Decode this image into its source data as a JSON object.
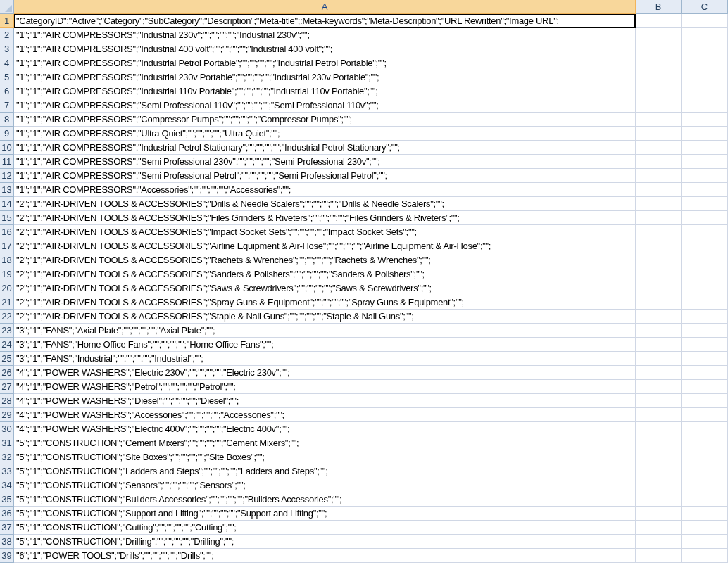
{
  "sheet": {
    "columns": [
      {
        "label": "A",
        "selected": true
      },
      {
        "label": "B",
        "selected": false
      },
      {
        "label": "C",
        "selected": false
      }
    ],
    "rows": [
      {
        "number": "1",
        "selected": true,
        "cell_a": "\"CategoryID\";\"Active\";\"Category\";\"SubCategory\";\"Description\";\"Meta-title\";:Meta-keywords\";\"Meta-Description\";\"URL Rewritten\";\"Image URL\";"
      },
      {
        "number": "2",
        "selected": false,
        "cell_a": "\"1\";\"1\";\"AIR COMPRESSORS\";\"Industrial 230v\";\"\";\"\";\"\";\"\";\"Industrial 230v\";\"\";"
      },
      {
        "number": "3",
        "selected": false,
        "cell_a": "\"1\";\"1\";\"AIR COMPRESSORS\";\"Industrial 400 volt\";\"\";\"\";\"\";\"\";\"Industrial 400 volt\";\"\";"
      },
      {
        "number": "4",
        "selected": false,
        "cell_a": "\"1\";\"1\";\"AIR COMPRESSORS\";\"Industrial Petrol Portable\";\"\";\"\";\"\";\"\";\"Industrial Petrol Portable\";\"\";"
      },
      {
        "number": "5",
        "selected": false,
        "cell_a": "\"1\";\"1\";\"AIR COMPRESSORS\";\"Industrial 230v Portable\";\"\";\"\";\"\";\"\";\"Industrial 230v Portable\";\"\";"
      },
      {
        "number": "6",
        "selected": false,
        "cell_a": "\"1\";\"1\";\"AIR COMPRESSORS\";\"Industrial 110v Portable\";\"\";\"\";\"\";\"\";\"Industrial 110v Portable\";\"\";"
      },
      {
        "number": "7",
        "selected": false,
        "cell_a": "\"1\";\"1\";\"AIR COMPRESSORS\";\"Semi Professional 110v\";\"\";\"\";\"\";\"\";\"Semi Professional 110v\";\"\";"
      },
      {
        "number": "8",
        "selected": false,
        "cell_a": "\"1\";\"1\";\"AIR COMPRESSORS\";\"Compressor Pumps\";\"\";\"\";\"\";\"\";\"Compressor Pumps\";\"\";"
      },
      {
        "number": "9",
        "selected": false,
        "cell_a": "\"1\";\"1\";\"AIR COMPRESSORS\";\"Ultra Quiet\";\"\";\"\";\"\";\"\";\"Ultra Quiet\";\"\";"
      },
      {
        "number": "10",
        "selected": false,
        "cell_a": "\"1\";\"1\";\"AIR COMPRESSORS\";\"Industrial Petrol Stationary\";\"\";\"\";\"\";\"\";\"Industrial Petrol Stationary\";\"\";"
      },
      {
        "number": "11",
        "selected": false,
        "cell_a": "\"1\";\"1\";\"AIR COMPRESSORS\";\"Semi Professional 230v\";\"\";\"\";\"\";\"\";\"Semi Professional 230v\";\"\";"
      },
      {
        "number": "12",
        "selected": false,
        "cell_a": "\"1\";\"1\";\"AIR COMPRESSORS\";\"Semi Professional Petrol\";\"\";\"\";\"\";\"\";\"Semi Professional Petrol\";\"\";"
      },
      {
        "number": "13",
        "selected": false,
        "cell_a": "\"1\";\"1\";\"AIR COMPRESSORS\";\"Accessories\";\"\";\"\";\"\";\"\";\"Accessories\";\"\";"
      },
      {
        "number": "14",
        "selected": false,
        "cell_a": "\"2\";\"1\";\"AIR-DRIVEN TOOLS & ACCESSORIES\";\"Drills & Needle Scalers\";\"\";\"\";\"\";\"\";\"Drills & Needle Scalers\";\"\";"
      },
      {
        "number": "15",
        "selected": false,
        "cell_a": "\"2\";\"1\";\"AIR-DRIVEN TOOLS & ACCESSORIES\";\"Files Grinders & Riveters\";\"\";\"\";\"\";\"\";\"Files Grinders & Riveters\";\"\";"
      },
      {
        "number": "16",
        "selected": false,
        "cell_a": "\"2\";\"1\";\"AIR-DRIVEN TOOLS & ACCESSORIES\";\"Impact Socket Sets\";\"\";\"\";\"\";\"\";\"Impact Socket Sets\";\"\";"
      },
      {
        "number": "17",
        "selected": false,
        "cell_a": "\"2\";\"1\";\"AIR-DRIVEN TOOLS & ACCESSORIES\";\"Airline Equipment & Air-Hose\";\"\";\"\";\"\";\"\";\"Airline Equipment & Air-Hose\";\"\";"
      },
      {
        "number": "18",
        "selected": false,
        "cell_a": "\"2\";\"1\";\"AIR-DRIVEN TOOLS & ACCESSORIES\";\"Rachets & Wrenches\";\"\";\"\";\"\";\"\";\"Rachets & Wrenches\";\"\";"
      },
      {
        "number": "19",
        "selected": false,
        "cell_a": "\"2\";\"1\";\"AIR-DRIVEN TOOLS & ACCESSORIES\";\"Sanders & Polishers\";\"\";\"\";\"\";\"\";\"Sanders & Polishers\";\"\";"
      },
      {
        "number": "20",
        "selected": false,
        "cell_a": "\"2\";\"1\";\"AIR-DRIVEN TOOLS & ACCESSORIES\";\"Saws & Screwdrivers\";\"\";\"\";\"\";\"\";\"Saws & Screwdrivers\";\"\";"
      },
      {
        "number": "21",
        "selected": false,
        "cell_a": "\"2\";\"1\";\"AIR-DRIVEN TOOLS & ACCESSORIES\";\"Spray Guns & Equipment\";\"\";\"\";\"\";\"\";\"Spray Guns & Equipment\";\"\";"
      },
      {
        "number": "22",
        "selected": false,
        "cell_a": "\"2\";\"1\";\"AIR-DRIVEN TOOLS & ACCESSORIES\";\"Staple & Nail Guns\";\"\";\"\";\"\";\"\";\"Staple & Nail Guns\";\"\";"
      },
      {
        "number": "23",
        "selected": false,
        "cell_a": "\"3\";\"1\";\"FANS\";\"Axial Plate\";\"\";\"\";\"\";\"\";\"Axial Plate\";\"\";"
      },
      {
        "number": "24",
        "selected": false,
        "cell_a": "\"3\";\"1\";\"FANS\";\"Home Office Fans\";\"\";\"\";\"\";\"\";\"Home Office Fans\";\"\";"
      },
      {
        "number": "25",
        "selected": false,
        "cell_a": "\"3\";\"1\";\"FANS\";\"Industrial\";\"\";\"\";\"\";\"\";\"Industrial\";\"\";"
      },
      {
        "number": "26",
        "selected": false,
        "cell_a": "\"4\";\"1\";\"POWER WASHERS\";\"Electric 230v\";\"\";\"\";\"\";\"\";\"Electric 230v\";\"\";"
      },
      {
        "number": "27",
        "selected": false,
        "cell_a": "\"4\";\"1\";\"POWER WASHERS\";\"Petrol\";\"\";\"\";\"\";\"\";\"Petrol\";\"\";"
      },
      {
        "number": "28",
        "selected": false,
        "cell_a": "\"4\";\"1\";\"POWER WASHERS\";\"Diesel\";\"\";\"\";\"\";\"\";\"Diesel\";\"\";"
      },
      {
        "number": "29",
        "selected": false,
        "cell_a": "\"4\";\"1\";\"POWER WASHERS\";\"Accessories\";\"\";\"\";\"\";\"\";\"Accessories\";\"\";"
      },
      {
        "number": "30",
        "selected": false,
        "cell_a": "\"4\";\"1\";\"POWER WASHERS\";\"Electric 400v\";\"\";\"\";\"\";\"\";\"Electric 400v\";\"\";"
      },
      {
        "number": "31",
        "selected": false,
        "cell_a": "\"5\";\"1\";\"CONSTRUCTION\";\"Cement Mixers\";\"\";\"\";\"\";\"\";\"Cement Mixers\";\"\";"
      },
      {
        "number": "32",
        "selected": false,
        "cell_a": "\"5\";\"1\";\"CONSTRUCTION\";\"Site Boxes\";\"\";\"\";\"\";\"\";\"Site Boxes\";\"\";"
      },
      {
        "number": "33",
        "selected": false,
        "cell_a": "\"5\";\"1\";\"CONSTRUCTION\";\"Ladders and Steps\";\"\";\"\";\"\";\"\";\"Ladders and Steps\";\"\";"
      },
      {
        "number": "34",
        "selected": false,
        "cell_a": "\"5\";\"1\";\"CONSTRUCTION\";\"Sensors\";\"\";\"\";\"\";\"\";\"Sensors\";\"\";"
      },
      {
        "number": "35",
        "selected": false,
        "cell_a": "\"5\";\"1\";\"CONSTRUCTION\";\"Builders Accessories\";\"\";\"\";\"\";\"\";\"Builders Accessories\";\"\";"
      },
      {
        "number": "36",
        "selected": false,
        "cell_a": "\"5\";\"1\";\"CONSTRUCTION\";\"Support and Lifting\";\"\";\"\";\"\";\"\";\"Support and Lifting\";\"\";"
      },
      {
        "number": "37",
        "selected": false,
        "cell_a": "\"5\";\"1\";\"CONSTRUCTION\";\"Cutting\";\"\";\"\";\"\";\"\";\"Cutting\";\"\";"
      },
      {
        "number": "38",
        "selected": false,
        "cell_a": "\"5\";\"1\";\"CONSTRUCTION\";\"Drilling\";\"\";\"\";\"\";\"\";\"Drilling\";\"\";"
      },
      {
        "number": "39",
        "selected": false,
        "cell_a": "\"6\";\"1\";\"POWER TOOLS\";\"Drills\";\"\";\"\";\"\";\"\";\"Drills\";\"\";"
      }
    ]
  }
}
